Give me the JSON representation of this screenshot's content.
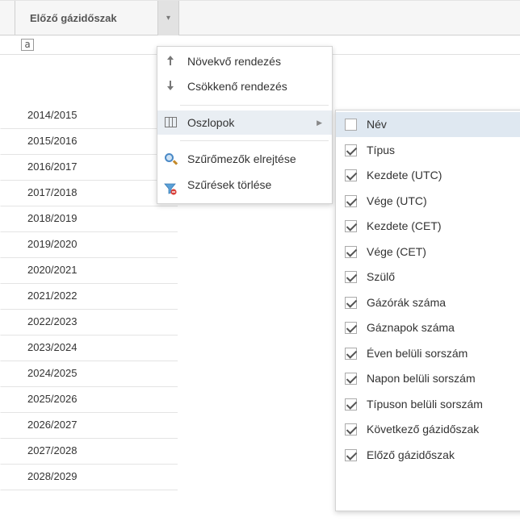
{
  "grid": {
    "column_header": "Előző gázidőszak",
    "trigger_glyph": "▾",
    "filter_glyph": "a",
    "rows": [
      "2014/2015",
      "2015/2016",
      "2016/2017",
      "2017/2018",
      "2018/2019",
      "2019/2020",
      "2020/2021",
      "2021/2022",
      "2022/2023",
      "2023/2024",
      "2024/2025",
      "2025/2026",
      "2026/2027",
      "2027/2028",
      "2028/2029"
    ]
  },
  "column_menu": {
    "sort_asc": "Növekvő rendezés",
    "sort_desc": "Csökkenő rendezés",
    "columns": "Oszlopok",
    "hide_filters": "Szűrőmezők elrejtése",
    "clear_filters": "Szűrések törlése"
  },
  "columns_submenu": {
    "items": [
      {
        "label": "Név",
        "checked": false
      },
      {
        "label": "Típus",
        "checked": true
      },
      {
        "label": "Kezdete (UTC)",
        "checked": true
      },
      {
        "label": "Vége (UTC)",
        "checked": true
      },
      {
        "label": "Kezdete (CET)",
        "checked": true
      },
      {
        "label": "Vége (CET)",
        "checked": true
      },
      {
        "label": "Szülő",
        "checked": true
      },
      {
        "label": "Gázórák száma",
        "checked": true
      },
      {
        "label": "Gáznapok száma",
        "checked": true
      },
      {
        "label": "Éven belüli sorszám",
        "checked": true
      },
      {
        "label": "Napon belüli sorszám",
        "checked": true
      },
      {
        "label": "Típuson belüli sorszám",
        "checked": true
      },
      {
        "label": "Következő gázidőszak",
        "checked": true
      },
      {
        "label": "Előző gázidőszak",
        "checked": true
      }
    ]
  }
}
